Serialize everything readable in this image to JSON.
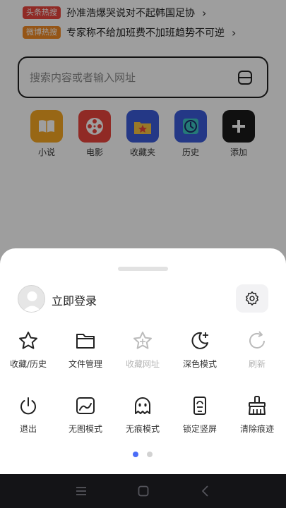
{
  "hot_news": [
    {
      "badge": "头条热搜",
      "text": "孙准浩爆哭说对不起韩国足协",
      "chevron": "›",
      "badge_color": "#e8453c"
    },
    {
      "badge": "微博热搜",
      "text": "专家称不给加班费不加班趋势不可逆",
      "chevron": "›",
      "badge_color": "#f08a24"
    }
  ],
  "search": {
    "placeholder": "搜索内容或者输入网址",
    "icon": "scan-icon"
  },
  "shortcuts": [
    {
      "label": "小说",
      "icon": "book-icon",
      "color": "#f5a623"
    },
    {
      "label": "电影",
      "icon": "film-reel-icon",
      "color": "#e8453c"
    },
    {
      "label": "收藏夹",
      "icon": "star-folder-icon",
      "color": "#3a5bd9"
    },
    {
      "label": "历史",
      "icon": "clock-icon",
      "color": "#3a5bd9"
    },
    {
      "label": "添加",
      "icon": "plus-icon",
      "color": "#1a1a1a"
    }
  ],
  "sheet": {
    "login_label": "立即登录",
    "menu_row1": [
      {
        "label": "收藏/历史",
        "icon": "star-icon",
        "enabled": true
      },
      {
        "label": "文件管理",
        "icon": "folder-icon",
        "enabled": true
      },
      {
        "label": "收藏网址",
        "icon": "star-plus-icon",
        "enabled": false
      },
      {
        "label": "深色模式",
        "icon": "moon-icon",
        "enabled": true
      },
      {
        "label": "刷新",
        "icon": "refresh-icon",
        "enabled": false
      }
    ],
    "menu_row2": [
      {
        "label": "退出",
        "icon": "power-icon",
        "enabled": true
      },
      {
        "label": "无图模式",
        "icon": "no-image-icon",
        "enabled": true
      },
      {
        "label": "无痕模式",
        "icon": "ghost-icon",
        "enabled": true
      },
      {
        "label": "锁定竖屏",
        "icon": "lock-portrait-icon",
        "enabled": true
      },
      {
        "label": "清除痕迹",
        "icon": "broom-icon",
        "enabled": true
      }
    ],
    "page_indicator": {
      "current": 1,
      "total": 2
    },
    "accent_color": "#4a6cf7"
  },
  "nav": {
    "buttons": [
      "menu-icon",
      "home-icon",
      "back-icon"
    ]
  }
}
